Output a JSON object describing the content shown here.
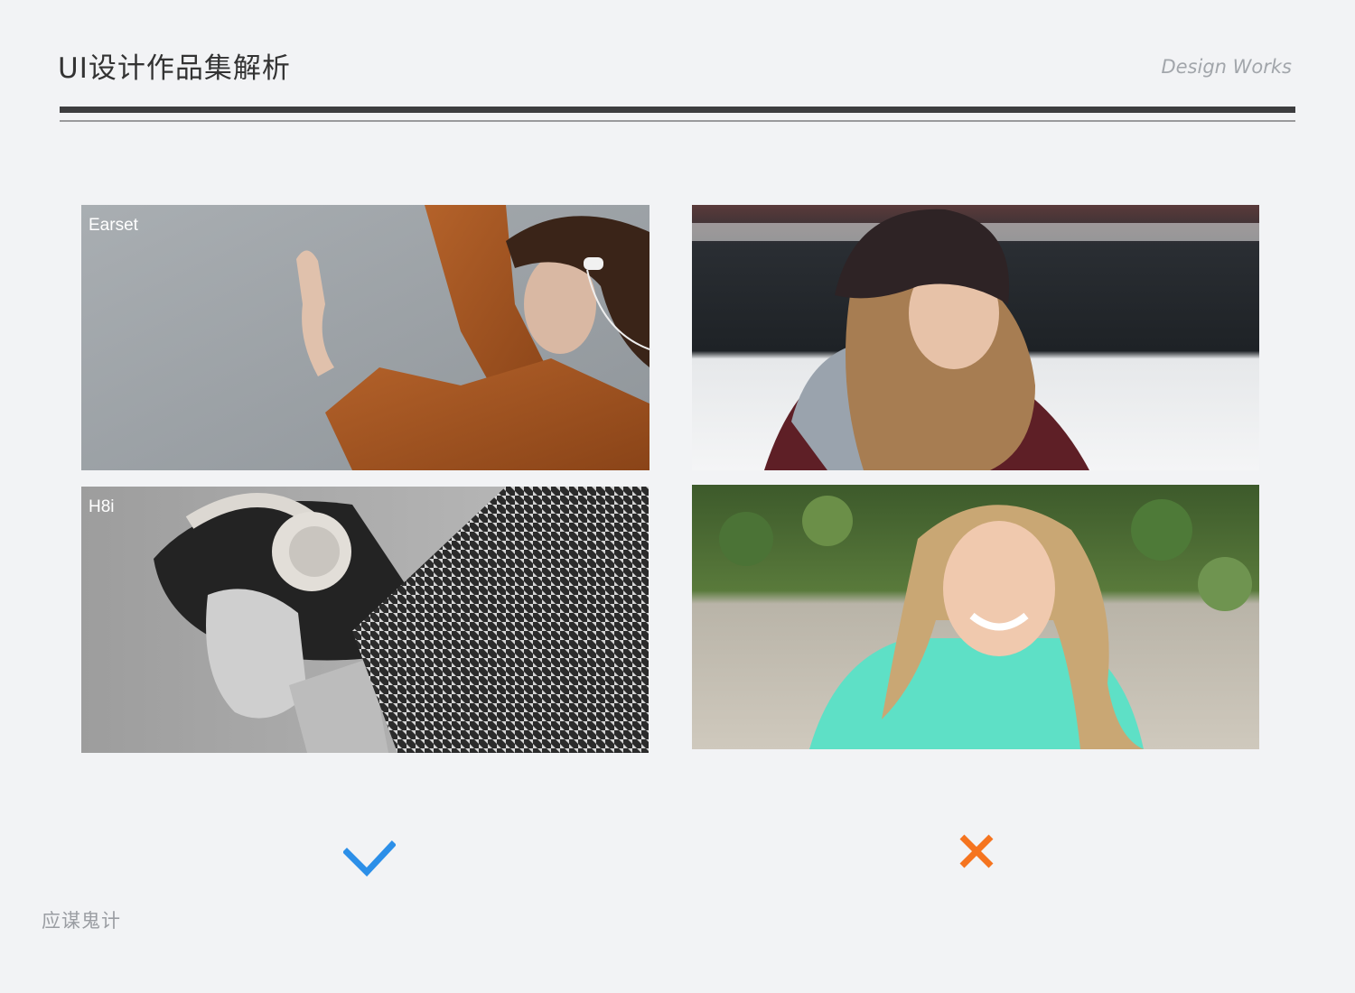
{
  "header": {
    "title": "UI设计作品集解析",
    "subtitle": "Design Works"
  },
  "good_examples": [
    {
      "label": "Earset"
    },
    {
      "label": "H8i"
    }
  ],
  "good_mark_icon": "check-icon",
  "bad_mark_icon": "cross-icon",
  "colors": {
    "good": "#2c8fe8",
    "bad": "#f5741f",
    "background": "#f2f3f5"
  },
  "footer": {
    "text": "应谋鬼计"
  }
}
